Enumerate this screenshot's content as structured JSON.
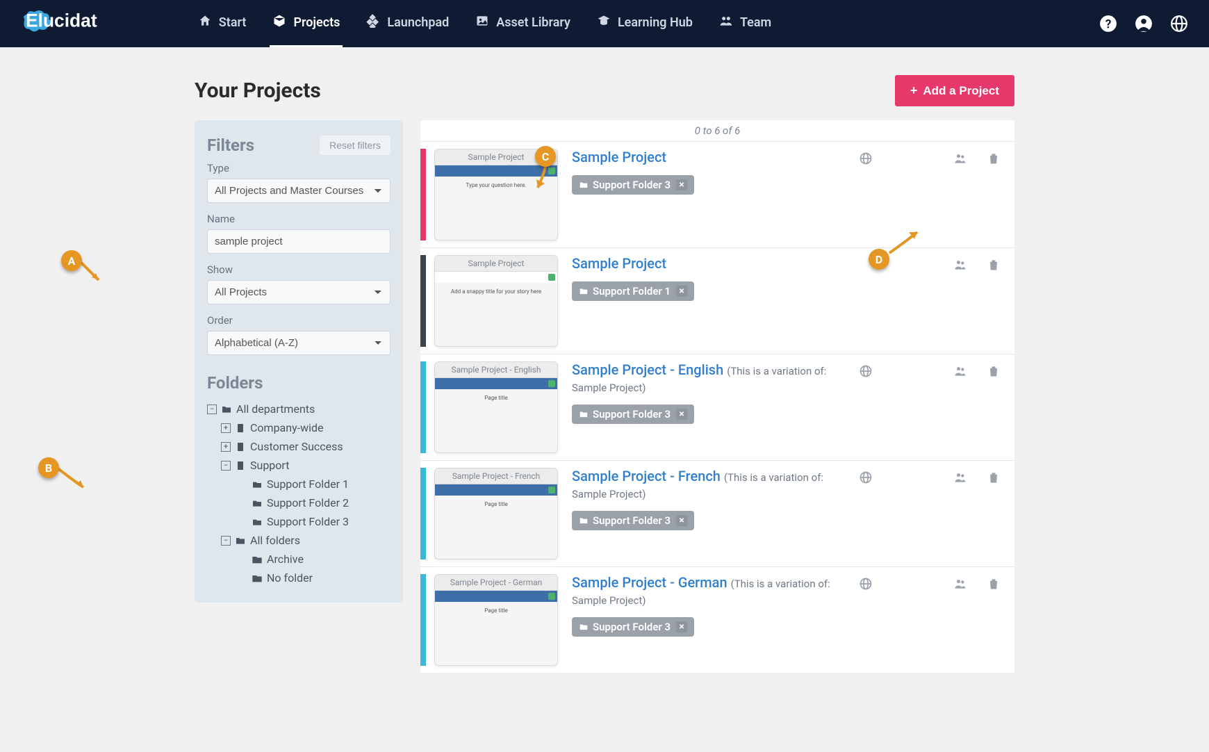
{
  "brand": "Elucidat",
  "nav": {
    "items": [
      {
        "label": "Start",
        "icon": "home"
      },
      {
        "label": "Projects",
        "icon": "box",
        "active": true
      },
      {
        "label": "Launchpad",
        "icon": "diamond"
      },
      {
        "label": "Asset Library",
        "icon": "image"
      },
      {
        "label": "Learning Hub",
        "icon": "grad"
      },
      {
        "label": "Team",
        "icon": "team"
      }
    ]
  },
  "page": {
    "title": "Your Projects",
    "add_btn": "Add a Project"
  },
  "filters": {
    "title": "Filters",
    "reset": "Reset filters",
    "type_label": "Type",
    "type_value": "All Projects and Master Courses",
    "name_label": "Name",
    "name_value": "sample project",
    "show_label": "Show",
    "show_value": "All Projects",
    "order_label": "Order",
    "order_value": "Alphabetical (A-Z)"
  },
  "folders": {
    "title": "Folders",
    "root": "All departments",
    "dept1": "Company-wide",
    "dept2": "Customer Success",
    "dept3": "Support",
    "support1": "Support Folder 1",
    "support2": "Support Folder 2",
    "support3": "Support Folder 3",
    "allfolders": "All folders",
    "archive": "Archive",
    "nofolder": "No folder"
  },
  "list": {
    "count_text": "0 to 6 of 6",
    "projects": [
      {
        "title": "Sample Project",
        "folder": "Support Folder 3",
        "color": "#e6386a",
        "thumb_title": "Sample Project",
        "thumb_caption": "Type your question here.",
        "thumb_hdr": "#3f6fa8",
        "globe": true
      },
      {
        "title": "Sample Project",
        "folder": "Support Folder 1",
        "color": "#3d434c",
        "thumb_title": "Sample Project",
        "thumb_caption": "Add a snappy title for your story here",
        "thumb_hdr": "#ffffff",
        "globe": false
      },
      {
        "title": "Sample Project - English",
        "note": "(This is a variation of: Sample Project)",
        "folder": "Support Folder 3",
        "color": "#3ab9d6",
        "thumb_title": "Sample Project - English",
        "thumb_caption": "Page title",
        "thumb_hdr": "#3f6fa8",
        "globe": true
      },
      {
        "title": "Sample Project - French",
        "note": "(This is a variation of: Sample Project)",
        "folder": "Support Folder 3",
        "color": "#3ab9d6",
        "thumb_title": "Sample Project - French",
        "thumb_caption": "Page title",
        "thumb_hdr": "#3f6fa8",
        "globe": true
      },
      {
        "title": "Sample Project - German",
        "note": "(This is a variation of: Sample Project)",
        "folder": "Support Folder 3",
        "color": "#3ab9d6",
        "thumb_title": "Sample Project - German",
        "thumb_caption": "Page title",
        "thumb_hdr": "#3f6fa8",
        "globe": true
      }
    ]
  },
  "annotations": {
    "A": "A",
    "B": "B",
    "C": "C",
    "D": "D"
  }
}
